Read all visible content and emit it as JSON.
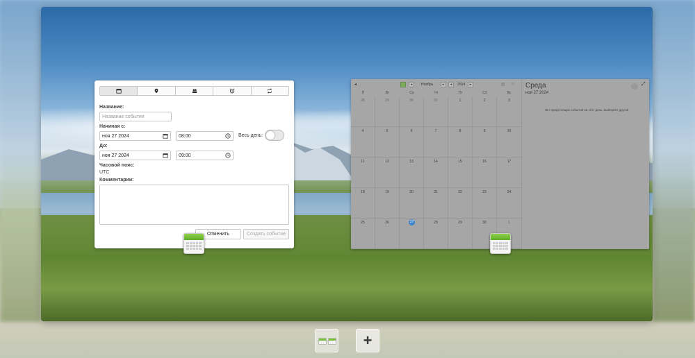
{
  "event_dialog": {
    "tabs": [
      {
        "name": "calendar-icon"
      },
      {
        "name": "location-pin-icon"
      },
      {
        "name": "attendees-icon"
      },
      {
        "name": "alarm-clock-icon"
      },
      {
        "name": "repeat-icon"
      }
    ],
    "title_label": "Название:",
    "title_placeholder": "Название события",
    "start_label": "Начиная с:",
    "start_date": "ноя 27 2024",
    "start_time": "08:00",
    "all_day_label": "Весь день:",
    "end_label": "До:",
    "end_date": "ноя 27 2024",
    "end_time": "09:00",
    "timezone_label": "Часовой пояс:",
    "timezone_value": "UTC",
    "comment_label": "Комментарии:",
    "cancel_label": "Отменить",
    "create_label": "Создать событие"
  },
  "calendar": {
    "month": "Ноябрь",
    "year": "2024",
    "weekday_headers": [
      "П",
      "Вт",
      "Ср",
      "Чт",
      "Пт",
      "Сб",
      "Вс"
    ],
    "days": [
      {
        "n": "28",
        "other": true
      },
      {
        "n": "29",
        "other": true
      },
      {
        "n": "30",
        "other": true
      },
      {
        "n": "31",
        "other": true
      },
      {
        "n": "1"
      },
      {
        "n": "2"
      },
      {
        "n": "3"
      },
      {
        "n": "4"
      },
      {
        "n": "5"
      },
      {
        "n": "6"
      },
      {
        "n": "7"
      },
      {
        "n": "8"
      },
      {
        "n": "9"
      },
      {
        "n": "10"
      },
      {
        "n": "11"
      },
      {
        "n": "12"
      },
      {
        "n": "13"
      },
      {
        "n": "14"
      },
      {
        "n": "15"
      },
      {
        "n": "16"
      },
      {
        "n": "17"
      },
      {
        "n": "18"
      },
      {
        "n": "19"
      },
      {
        "n": "20"
      },
      {
        "n": "21"
      },
      {
        "n": "22"
      },
      {
        "n": "23"
      },
      {
        "n": "24"
      },
      {
        "n": "25"
      },
      {
        "n": "26"
      },
      {
        "n": "27",
        "today": true
      },
      {
        "n": "28"
      },
      {
        "n": "29"
      },
      {
        "n": "30"
      },
      {
        "n": "1",
        "other": true
      }
    ],
    "selected_weekday": "Среда",
    "selected_date": "ноя 27 2024",
    "no_events_text": "Нет предстоящих событий на этот день, выберите другой"
  },
  "dock": {
    "add_label": "+"
  }
}
